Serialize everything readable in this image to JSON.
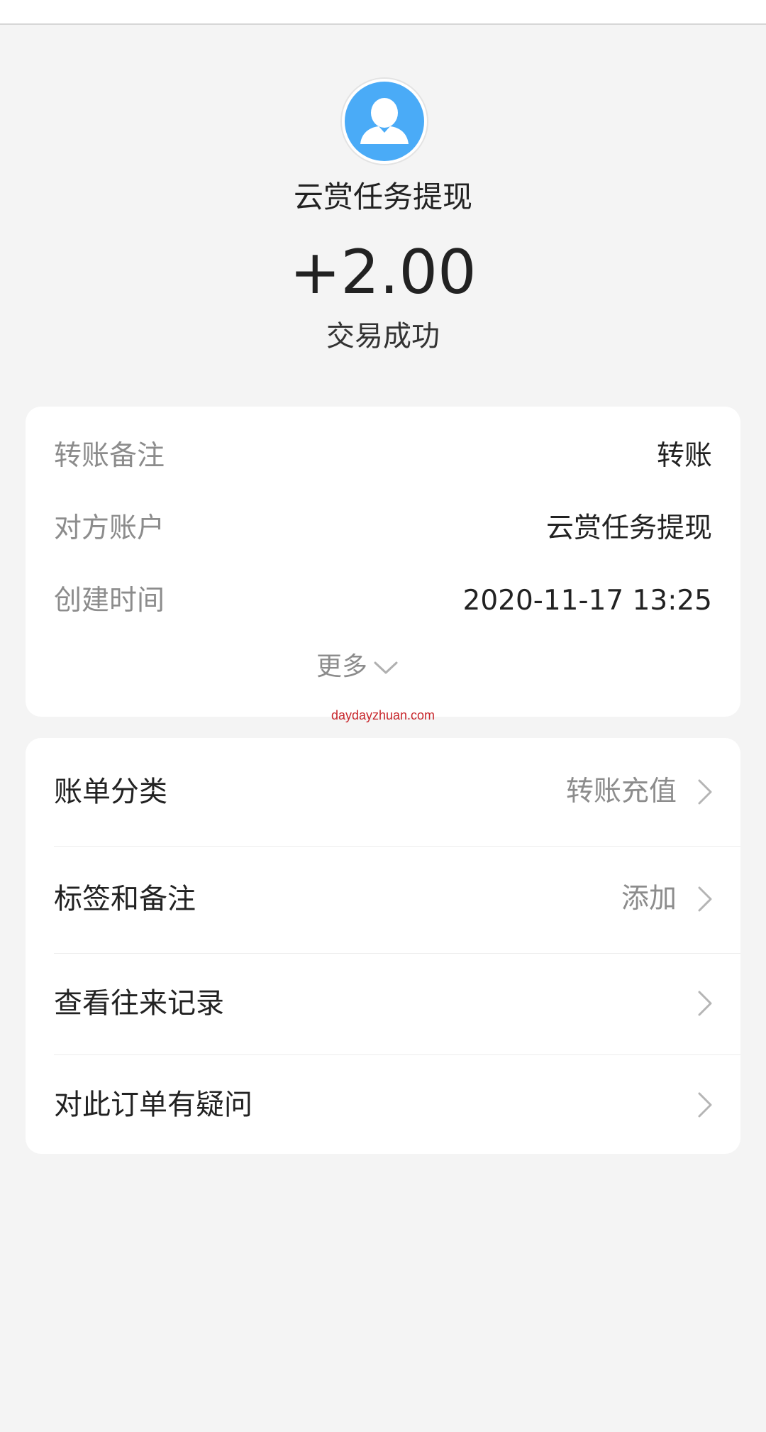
{
  "header": {
    "payer_name": "云赏任务提现",
    "amount": "+2.00",
    "status": "交易成功",
    "avatar_icon": "user-avatar-icon",
    "avatar_color": "#4aabf7"
  },
  "details": {
    "rows": [
      {
        "label": "转账备注",
        "value": "转账"
      },
      {
        "label": "对方账户",
        "value": "云赏任务提现"
      },
      {
        "label": "创建时间",
        "value": "2020-11-17 13:25"
      }
    ],
    "more_label": "更多",
    "more_icon": "chevron-down-icon"
  },
  "watermark": "daydayzhuan.com",
  "menu": {
    "items": [
      {
        "label": "账单分类",
        "value": "转账充值"
      },
      {
        "label": "标签和备注",
        "value": "添加"
      },
      {
        "label": "查看往来记录",
        "value": ""
      },
      {
        "label": "对此订单有疑问",
        "value": ""
      }
    ],
    "arrow_icon": "chevron-right-icon"
  }
}
